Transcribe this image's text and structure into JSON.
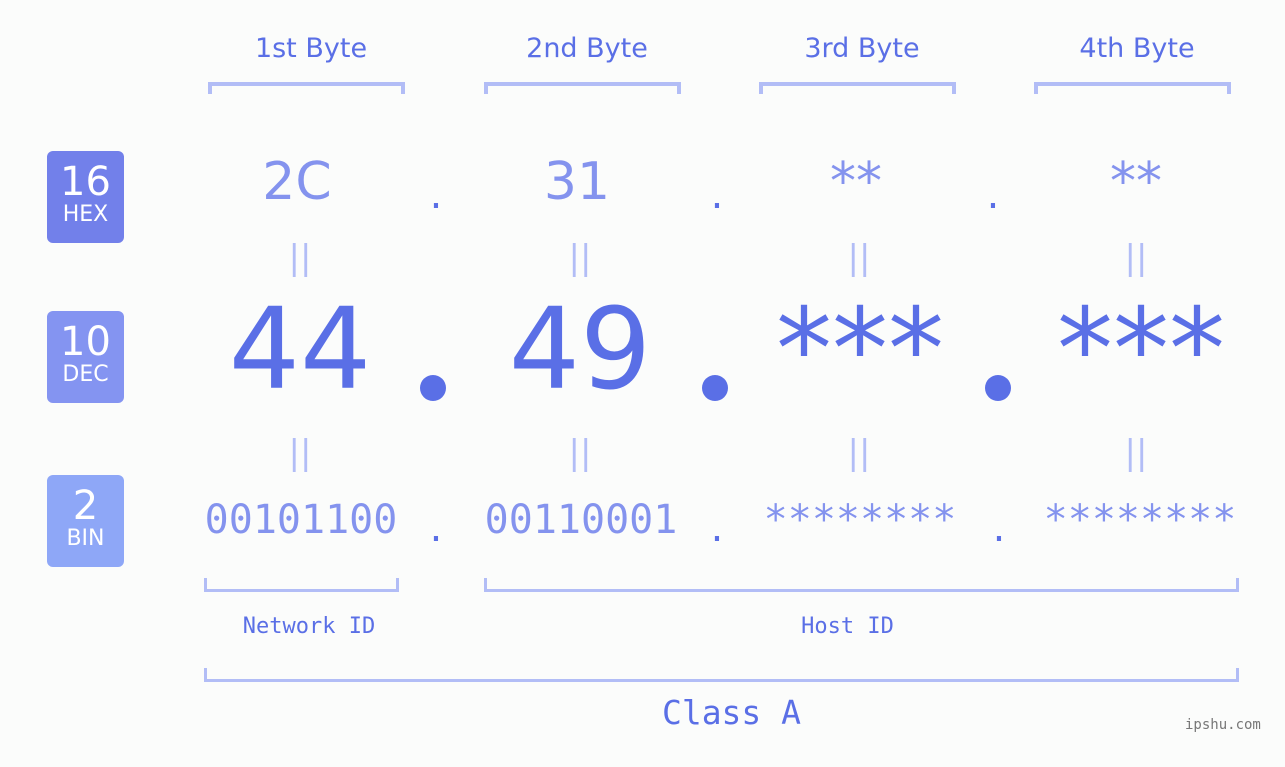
{
  "headers": [
    "1st Byte",
    "2nd Byte",
    "3rd Byte",
    "4th Byte"
  ],
  "badges": {
    "hex": {
      "num": "16",
      "label": "HEX",
      "color": "#7280ea"
    },
    "dec": {
      "num": "10",
      "label": "DEC",
      "color": "#8494f1"
    },
    "bin": {
      "num": "2",
      "label": "BIN",
      "color": "#8ea7f7"
    }
  },
  "hex_values": [
    "2C",
    "31",
    "**",
    "**"
  ],
  "dec_values": [
    "44",
    "49",
    "***",
    "***"
  ],
  "bin_values": [
    "00101100",
    "00110001",
    "********",
    "********"
  ],
  "separator": ".",
  "equals": "||",
  "labels": {
    "network": "Network ID",
    "host": "Host ID",
    "class": "Class A"
  },
  "watermark": "ipshu.com"
}
